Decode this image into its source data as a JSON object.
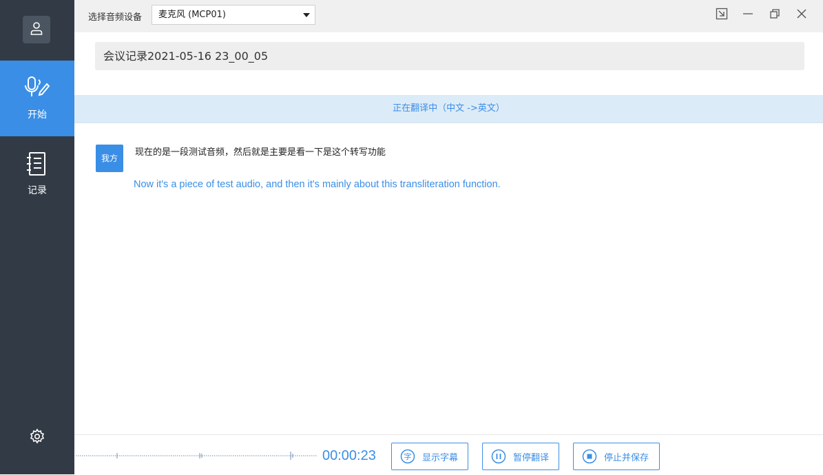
{
  "sidebar": {
    "items": [
      {
        "label": "开始",
        "icon": "microphone-pen-icon",
        "active": true
      },
      {
        "label": "记录",
        "icon": "notebook-icon",
        "active": false
      }
    ]
  },
  "topbar": {
    "device_label": "选择音频设备",
    "device_selected": "麦克风 (MCP01)"
  },
  "meeting": {
    "title": "会议记录2021-05-16 23_00_05"
  },
  "status": {
    "text": "正在翻译中（中文 ->英文）"
  },
  "transcript": [
    {
      "speaker": "我方",
      "source": "现在的是一段测试音频，然后就是主要是看一下是这个转写功能",
      "translation": "Now it's a piece of test audio, and then it's mainly about this transliteration function."
    }
  ],
  "controls": {
    "timer": "00:00:23",
    "subtitle_label": "显示字幕",
    "pause_label": "暂停翻译",
    "stop_label": "停止并保存"
  },
  "colors": {
    "accent": "#3a8ee6",
    "sidebar": "#323b45",
    "banner": "#dcebf8"
  }
}
